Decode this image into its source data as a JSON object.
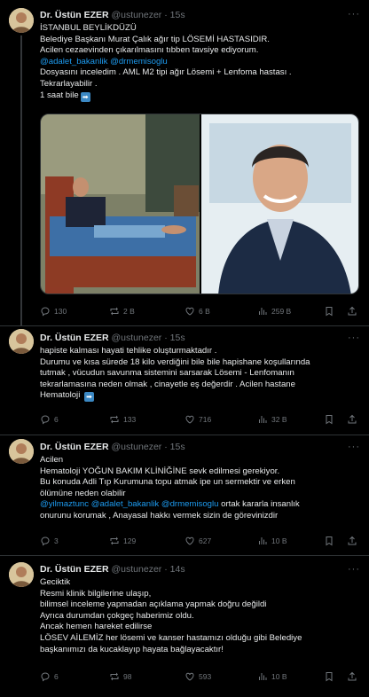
{
  "tweets": [
    {
      "author": "Dr. Üstün EZER",
      "handle": "@ustunezer",
      "sep": "·",
      "time": "15s",
      "lines": [
        [
          {
            "t": "İSTANBUL BEYLİKDÜZÜ"
          }
        ],
        [
          {
            "t": "Belediye Başkanı Murat Çalık ağır tip LÖSEMİ HASTASIDIR."
          }
        ],
        [
          {
            "t": "Acilen cezaevinden çıkarılmasını tıbben tavsiye ediyorum."
          }
        ],
        [
          {
            "t": "@adalet_bakanlik",
            "m": true
          },
          {
            "t": " "
          },
          {
            "t": "@drmemisoglu",
            "m": true
          }
        ],
        [
          {
            "t": "Dosyasını inceledim . AML M2 tipi ağır Lösemi + Lenfoma hastası ."
          }
        ],
        [
          {
            "t": "Tekrarlayabilir ."
          }
        ],
        [
          {
            "t": "1 saat bile"
          },
          {
            "emoji": "arrow-right"
          }
        ]
      ],
      "stats": {
        "replies": "130",
        "reposts": "2 B",
        "likes": "6 B",
        "views": "259 B"
      }
    },
    {
      "author": "Dr. Üstün EZER",
      "handle": "@ustunezer",
      "sep": "·",
      "time": "15s",
      "lines": [
        [
          {
            "t": "hapiste kalması hayati tehlike oluşturmaktadır ."
          }
        ],
        [
          {
            "t": "Durumu ve kısa sürede 18 kilo verdiğini bile bile hapishane koşullarında"
          }
        ],
        [
          {
            "t": "tutmak , vücudun savunma sistemini sarsarak Lösemi - Lenfomanın"
          }
        ],
        [
          {
            "t": "tekrarlamasına neden olmak , cinayetle eş değerdir . Acilen hastane"
          }
        ],
        [
          {
            "t": "Hematoloji "
          },
          {
            "emoji": "arrow-right"
          }
        ]
      ],
      "stats": {
        "replies": "6",
        "reposts": "133",
        "likes": "716",
        "views": "32 B"
      }
    },
    {
      "author": "Dr. Üstün EZER",
      "handle": "@ustunezer",
      "sep": "·",
      "time": "15s",
      "lines": [
        [
          {
            "t": "Acilen"
          }
        ],
        [
          {
            "t": "Hematoloji YOĞUN BAKIM KLİNİĞİNE sevk edilmesi gerekiyor."
          }
        ],
        [
          {
            "t": "Bu konuda Adli Tıp Kurumuna topu atmak ipe un sermektir ve erken"
          }
        ],
        [
          {
            "t": "ölümüne neden olabilir"
          }
        ],
        [
          {
            "t": "@yilmaztunc",
            "m": true
          },
          {
            "t": " "
          },
          {
            "t": "@adalet_bakanlik",
            "m": true
          },
          {
            "t": " "
          },
          {
            "t": "@drmemisoglu",
            "m": true
          },
          {
            "t": " ortak kararla insanlık"
          }
        ],
        [
          {
            "t": "onurunu korumak , Anayasal hakkı vermek sizin de görevinizdir"
          }
        ]
      ],
      "stats": {
        "replies": "3",
        "reposts": "129",
        "likes": "627",
        "views": "10 B"
      }
    },
    {
      "author": "Dr. Üstün EZER",
      "handle": "@ustunezer",
      "sep": "·",
      "time": "14s",
      "lines": [
        [
          {
            "t": "Geciktik"
          }
        ],
        [
          {
            "t": "Resmi klinik bilgilerine ulaşıp,"
          }
        ],
        [
          {
            "t": "bilimsel inceleme yapmadan açıklama yapmak doğru değildi"
          }
        ],
        [
          {
            "t": "Ayrıca durumdan çokgeç haberimiz oldu."
          }
        ],
        [
          {
            "t": "Ancak hemen hareket edilirse"
          }
        ],
        [
          {
            "t": "LÖSEV AİLEMİZ her lösemi ve kanser hastamızı olduğu gibi Belediye"
          }
        ],
        [
          {
            "t": "başkanımızı da kucaklayıp hayata bağlayacaktır!"
          }
        ]
      ],
      "stats": {
        "replies": "6",
        "reposts": "98",
        "likes": "593",
        "views": "10 B"
      }
    }
  ],
  "colors": {
    "bg": "#000000",
    "text": "#e7e9ea",
    "muted": "#71767b",
    "link": "#1d9bf0",
    "border": "#2f3336"
  }
}
